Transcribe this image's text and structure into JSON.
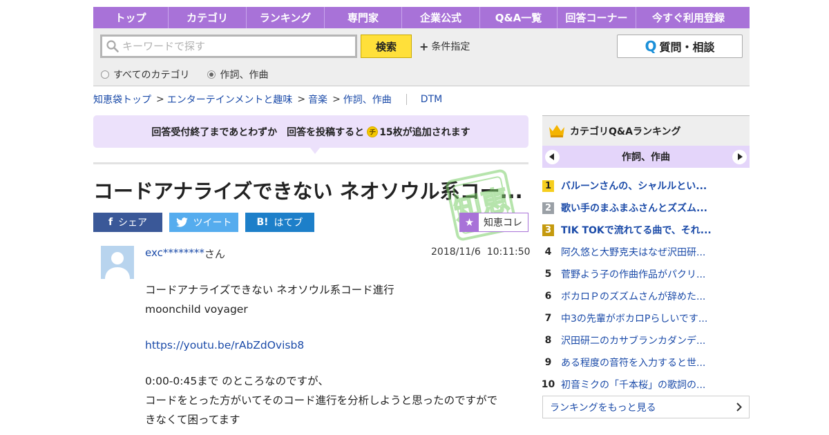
{
  "nav": {
    "items": [
      {
        "label": "トップ",
        "width": 109
      },
      {
        "label": "カテゴリ",
        "width": 113
      },
      {
        "label": "ランキング",
        "width": 113
      },
      {
        "label": "専門家",
        "width": 112
      },
      {
        "label": "企業公式",
        "width": 113
      },
      {
        "label": "Q&A一覧",
        "width": 112
      },
      {
        "label": "回答コーナー",
        "width": 114
      },
      {
        "label": "今すぐ利用登録",
        "width": 151
      }
    ]
  },
  "search": {
    "placeholder": "キーワードで探す",
    "button_label": "検索",
    "condition_label": "条件指定",
    "ask_label": "質問・相談",
    "ask_icon": "Q",
    "radios": [
      {
        "label": "すべてのカテゴリ",
        "checked": false
      },
      {
        "label": "作詞、作曲",
        "checked": true
      }
    ]
  },
  "breadcrumb": {
    "items": [
      "知恵袋トップ",
      "エンターテインメントと趣味",
      "音楽",
      "作詞、作曲"
    ],
    "separator": ">",
    "extra": "DTM"
  },
  "notice": {
    "text_before": "回答受付終了まであとわずか　回答を投稿すると",
    "coin": "チ",
    "text_after": "15枚が追加されます"
  },
  "question": {
    "title": "コードアナライズできない ネオソウル系コー...",
    "stamp_text": "知恵",
    "share": {
      "facebook": "シェア",
      "twitter": "ツイート",
      "hatena": "はてブ",
      "hatena_icon": "B!",
      "facebook_icon": "f"
    },
    "chie_label": "知恵コレ",
    "author": "exc********",
    "author_suffix": "さん",
    "date": "2018/11/6",
    "time": "10:11:50",
    "body": {
      "line1": "コードアナライズできない ネオソウル系コード進行",
      "line2": "moonchild voyager",
      "link": "https://youtu.be/rAbZdOvisb8",
      "line3": "0:00-0:45まで のところなのですが、",
      "line4": "コードをとった方がいてそのコード進行を分析しようと思ったのですがで",
      "line5": "きなくて困ってます"
    }
  },
  "ranking": {
    "title": "カテゴリQ&Aランキング",
    "category": "作詞、作曲",
    "items": [
      {
        "rank": "1",
        "text": "バルーンさんの、シャルルとい...",
        "style": "top1",
        "bold": true
      },
      {
        "rank": "2",
        "text": "歌い手のまふまふさんとズズム...",
        "style": "top2",
        "bold": true
      },
      {
        "rank": "3",
        "text": "TIK TOKで流れてる曲で、それ...",
        "style": "top3",
        "bold": true
      },
      {
        "rank": "4",
        "text": "阿久悠と大野克夫はなぜ沢田研...",
        "style": "plain",
        "bold": false
      },
      {
        "rank": "5",
        "text": "菅野よう子の作曲作品がパクリ...",
        "style": "plain",
        "bold": false
      },
      {
        "rank": "6",
        "text": "ボカロＰのズズムさんが辞めた...",
        "style": "plain",
        "bold": false
      },
      {
        "rank": "7",
        "text": "中3の先輩がボカロPらしいです...",
        "style": "plain",
        "bold": false
      },
      {
        "rank": "8",
        "text": "沢田研二のカサブランカダンデ...",
        "style": "plain",
        "bold": false
      },
      {
        "rank": "9",
        "text": "ある程度の音符を入力すると世...",
        "style": "plain",
        "bold": false
      },
      {
        "rank": "10",
        "text": "初音ミクの「千本桜」の歌詞の...",
        "style": "plain",
        "bold": false
      }
    ],
    "more_label": "ランキングをもっと見る"
  },
  "colors": {
    "nav_bg": "#a872d8",
    "link": "#1a4aa8",
    "search_button": "#ffe03a",
    "notice_bg": "#ece1fb",
    "facebook": "#3a5898",
    "twitter": "#55acee",
    "hatena": "#1d7fc9"
  }
}
